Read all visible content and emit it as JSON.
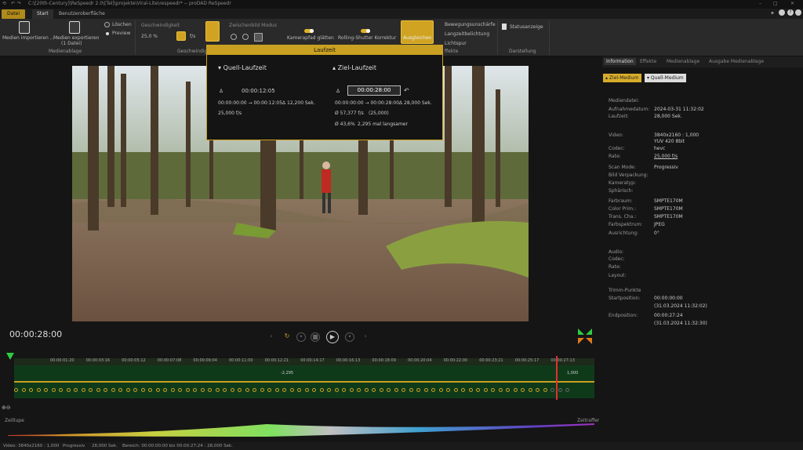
{
  "titlebar": {
    "path": "C:\\[20th-Century]\\ReSpeedr 2.0\\[Tel]\\projekte\\Viral-Lite\\respeedr* -- proDAD ReSpeedr"
  },
  "menu": {
    "datei": "Datei",
    "start": "Start",
    "ui": "Benutzeroberfläche"
  },
  "ribbon": {
    "import": "Medien importieren ...",
    "export": "Medien exportieren",
    "export_sub": "(1 Datei)",
    "loeschen": "Löschen",
    "preview": "Preview",
    "medienablage": "Medienablage",
    "geschw_label": "Geschwindigkeit",
    "geschw_value": "25,0 %",
    "fps_unit": "f/s",
    "zwischenbild": "Zwischenbild Modus",
    "geschw_group": "Geschwindigk",
    "kamera": "Kamerapfad glätten",
    "rolling": "Rolling-Shutter Korrektur",
    "ausgleichen": "Ausgleichen",
    "bewegung": "Bewegungsunschärfe",
    "langzeit": "Langzeitbelichtung",
    "lichtspur": "Lichtspur",
    "effekte": "ffekte",
    "statusanzeige": "Statusanzeige",
    "darstellung": "Darstellung"
  },
  "popup": {
    "title": "Laufzeit",
    "quell_title": "Quell-Laufzeit",
    "ziel_title": "Ziel-Laufzeit",
    "delta": "Δ",
    "quell_time": "00:00:12:05",
    "quell_range": "00:00:00:00 → 00:00:12:05",
    "quell_delta": "Δ 12,200 Sek.",
    "quell_fps": "25,000 f/s",
    "ziel_time": "00:00:28:00",
    "ziel_range": "00:00:00:00 → 00:00:28:00",
    "ziel_delta": "Δ 28,000 Sek.",
    "ziel_fps": "Ø 57,377 f/s",
    "ziel_fps2": "(25,000)",
    "ziel_pct": "Ø 43,6%",
    "ziel_slow": "2,295 mal langsamer"
  },
  "right": {
    "tabs": [
      "Information",
      "Effekte",
      "Medienablage",
      "Ausgabe Medienablage"
    ],
    "btn1": "Ziel-Medium",
    "btn2": "Quell-Medium",
    "rows": [
      {
        "k": "Mediendatei:",
        "v": ""
      },
      {
        "k": "Aufnahmedatum:",
        "v": "2024-03-31 11:32:02"
      },
      {
        "k": "Laufzeit:",
        "v": "28,000 Sek."
      },
      {
        "k": "Video:",
        "v": "3840x2160 : 1,000"
      },
      {
        "k": "",
        "v": "YUV 420 8bit"
      },
      {
        "k": "Codec:",
        "v": "hevc"
      },
      {
        "k": "Rate:",
        "v": "25,000 f/s"
      },
      {
        "k": "Scan Mode:",
        "v": "Progressiv"
      },
      {
        "k": "Bild Verpackung:",
        "v": ""
      },
      {
        "k": "Kameratyp:",
        "v": ""
      },
      {
        "k": "Sphärisch:",
        "v": ""
      },
      {
        "k": "Farbraum:",
        "v": "SMPTE170M"
      },
      {
        "k": "Color Prim.:",
        "v": "SMPTE170M"
      },
      {
        "k": "Trans. Cha.:",
        "v": "SMPTE170M"
      },
      {
        "k": "Farbspektrum:",
        "v": "JPEG"
      },
      {
        "k": "Ausrichtung:",
        "v": "0°"
      },
      {
        "k": "Audio:",
        "v": ""
      },
      {
        "k": "Codec:",
        "v": ""
      },
      {
        "k": "Rate:",
        "v": ""
      },
      {
        "k": "Layout:",
        "v": ""
      },
      {
        "k": "Trimm-Punkte",
        "v": ""
      },
      {
        "k": "Startposition:",
        "v": "00:00:00:00"
      },
      {
        "k": "",
        "v": "(31.03.2024 11:32:02)"
      },
      {
        "k": "Endposition:",
        "v": "00:00:27:24"
      },
      {
        "k": "",
        "v": "(31.03.2024 11:32:30)"
      }
    ]
  },
  "timeline": {
    "timecode": "00:00:28:00",
    "ticks": [
      "00:00:01:20",
      "00:00:03:16",
      "00:00:05:12",
      "00:00:07:08",
      "00:00:09:04",
      "00:00:11:00",
      "00:00:12:21",
      "00:00:14:17",
      "00:00:16:13",
      "00:00:18:09",
      "00:00:20:04",
      "00:00:22:00",
      "00:00:23:21",
      "00:00:25:17",
      "00:00:27:13"
    ],
    "speed_label": "-2,295",
    "speed_label2": "1,000",
    "zeitlupe": "Zeitlupe",
    "zeitraffer": "Zeitraffer"
  },
  "status": {
    "video": "Video: 3840x2160 : 1,000",
    "scan": "Progressiv",
    "dur": "28,000 Sek.",
    "range": "Bereich: 00:00:00:00 bis 00:00:27:24 : 28,000 Sek."
  },
  "colors": {
    "accent": "#c9a021",
    "green": "#2ecc40"
  }
}
